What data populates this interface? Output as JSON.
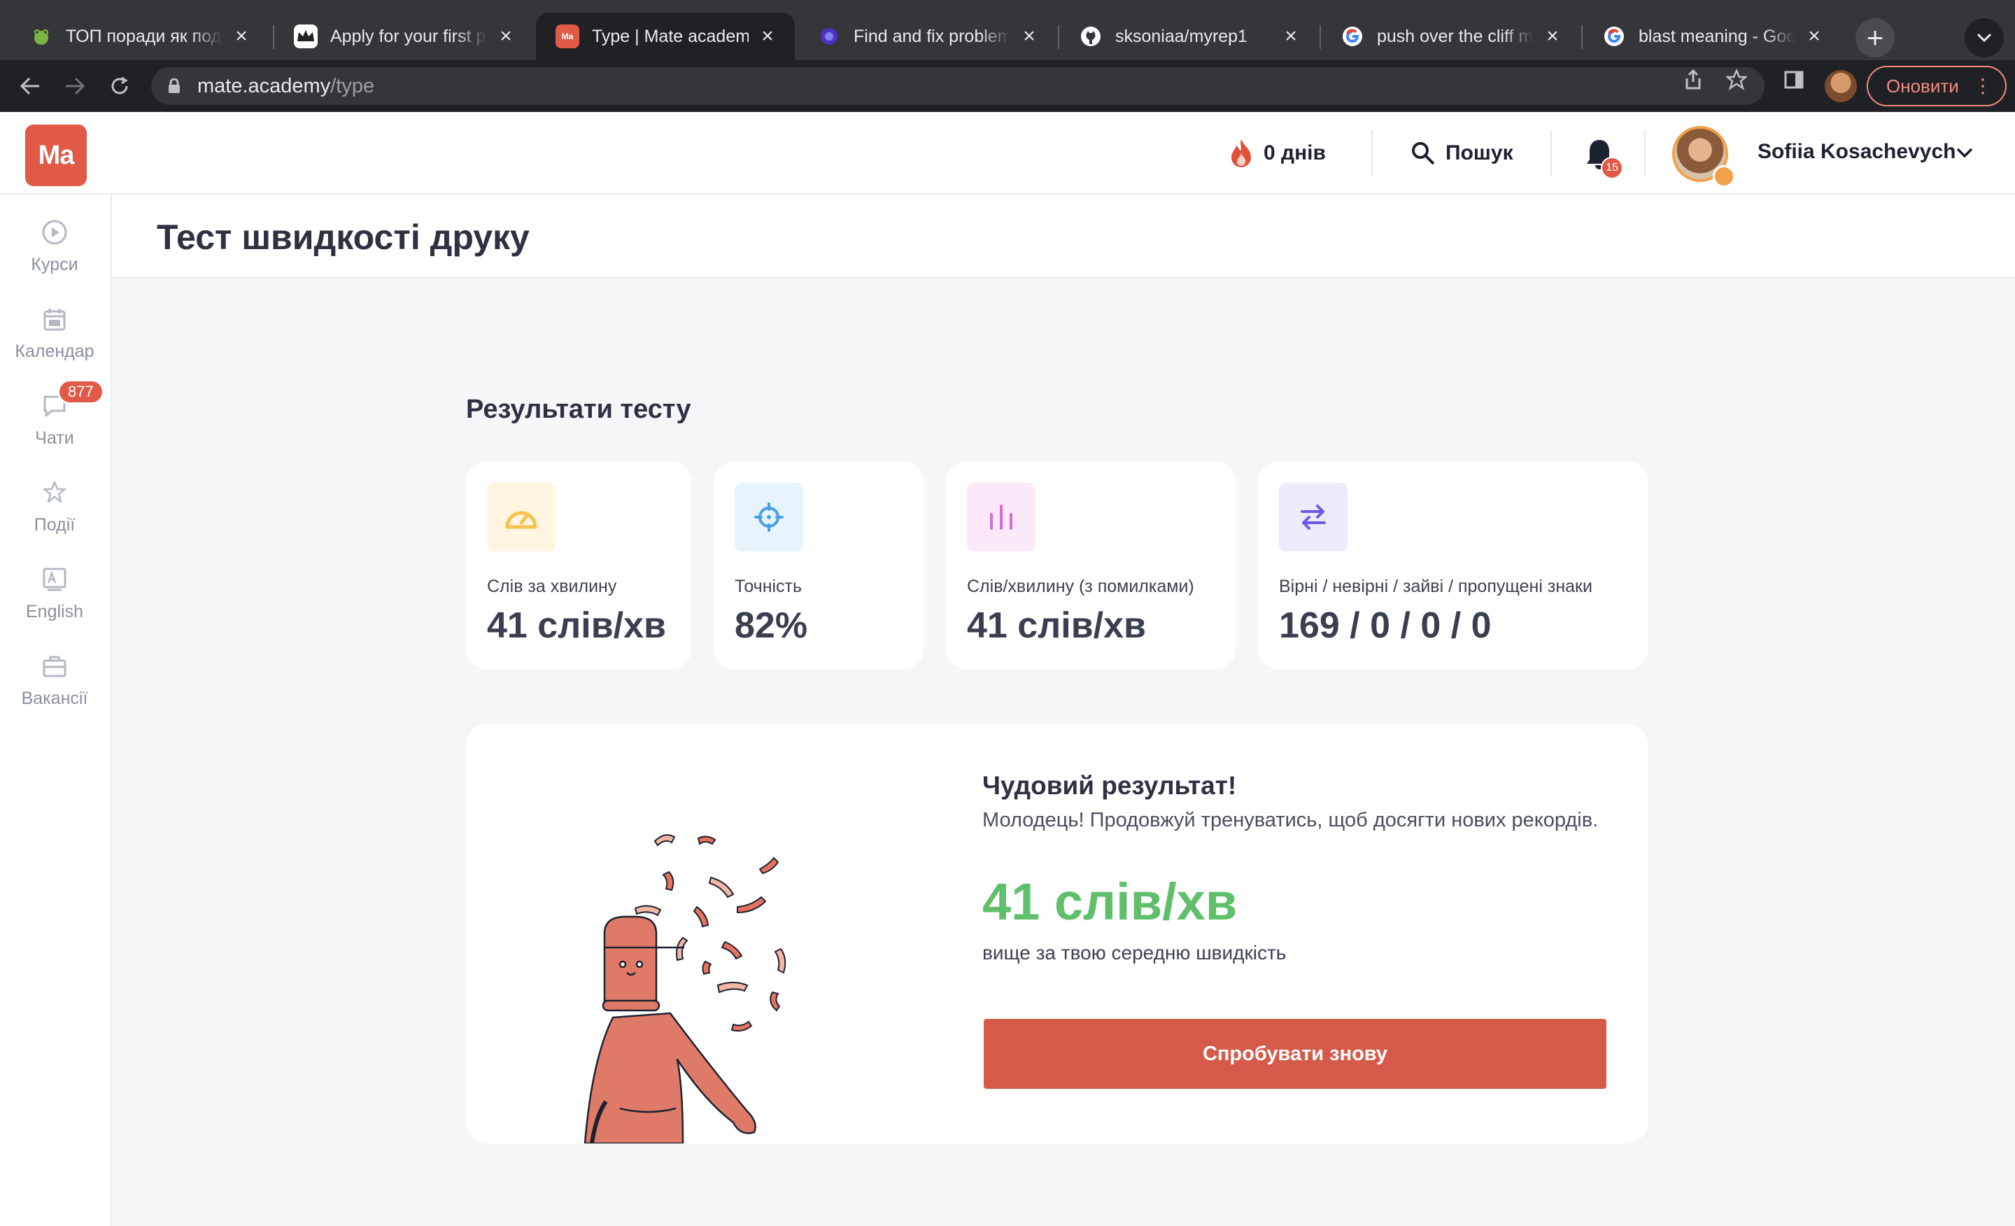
{
  "browser": {
    "tabs": [
      {
        "title": "ТОП поради як подолати",
        "icon": "frog-icon"
      },
      {
        "title": "Apply for your first project",
        "icon": "crown-icon"
      },
      {
        "title": "Type | Mate academy",
        "icon": "mate-academy-icon",
        "active": true
      },
      {
        "title": "Find and fix problems",
        "icon": "eslint-icon"
      },
      {
        "title": "sksoniaa/myrep1",
        "icon": "github-icon"
      },
      {
        "title": "push over the cliff meaning",
        "icon": "google-icon"
      },
      {
        "title": "blast meaning - Google Search",
        "icon": "google-icon"
      }
    ],
    "url_host": "mate.academy",
    "url_path": "/type",
    "update_label": "Оновити"
  },
  "header": {
    "logo": "Ma",
    "streak": "0 днів",
    "search_label": "Пошук",
    "notifications_count": "15",
    "user_name": "Sofiia Kosachevych"
  },
  "sidebar": {
    "items": [
      {
        "label": "Курси",
        "icon": "play-circle-icon"
      },
      {
        "label": "Календар",
        "icon": "calendar-icon"
      },
      {
        "label": "Чати",
        "icon": "chat-icon",
        "badge": "877"
      },
      {
        "label": "Події",
        "icon": "star-icon"
      },
      {
        "label": "English",
        "icon": "english-icon"
      },
      {
        "label": "Вакансії",
        "icon": "briefcase-icon"
      }
    ]
  },
  "page": {
    "title": "Тест швидкості друку",
    "results_title": "Результати тесту",
    "stats": [
      {
        "label": "Слів за хвилину",
        "value": "41 слів/хв",
        "icon": "speedometer-icon",
        "color": "#f4c44e"
      },
      {
        "label": "Точність",
        "value": "82%",
        "icon": "target-icon",
        "color": "#4a9fe8"
      },
      {
        "label": "Слів/хвилину (з помилками)",
        "value": "41 слів/хв",
        "icon": "bar-chart-icon",
        "color": "#d86ad0"
      },
      {
        "label": "Вірні / невірні / зайві / пропущені знаки",
        "value": "169 / 0 / 0 / 0",
        "icon": "swap-arrows-icon",
        "color": "#6b5ce7"
      }
    ],
    "result": {
      "heading": "Чудовий результат!",
      "message": "Молодець! Продовжуй тренуватись, щоб досягти нових рекордів.",
      "score": "41 слів/хв",
      "comparison": "вище за твою середню швидкість",
      "retry_label": "Спробувати знову"
    }
  },
  "colors": {
    "brand": "#e05a47",
    "success": "#5fbf6b",
    "button": "#d65a4a"
  }
}
